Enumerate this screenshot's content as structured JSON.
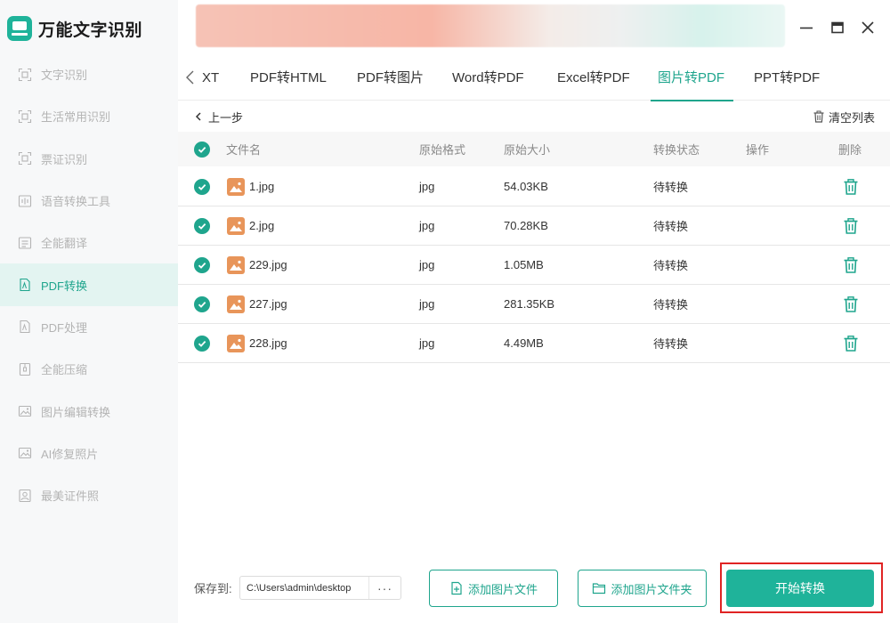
{
  "app": {
    "name": "万能文字识别"
  },
  "colors": {
    "accent": "#1fa58d",
    "button": "#1fb39a",
    "highlight": "#e02424",
    "file_icon": "#e8955a"
  },
  "sidebar": {
    "items": [
      {
        "label": "文字识别",
        "icon": "ocr-icon"
      },
      {
        "label": "生活常用识别",
        "icon": "ocr-icon"
      },
      {
        "label": "票证识别",
        "icon": "ocr-icon"
      },
      {
        "label": "语音转换工具",
        "icon": "audio-icon"
      },
      {
        "label": "全能翻译",
        "icon": "translate-icon"
      },
      {
        "label": "PDF转换",
        "icon": "pdf-icon",
        "active": true
      },
      {
        "label": "PDF处理",
        "icon": "pdf-icon"
      },
      {
        "label": "全能压缩",
        "icon": "compress-icon"
      },
      {
        "label": "图片编辑转换",
        "icon": "image-icon"
      },
      {
        "label": "AI修复照片",
        "icon": "image-icon"
      },
      {
        "label": "最美证件照",
        "icon": "id-photo-icon"
      }
    ]
  },
  "tabs": [
    {
      "label": "XT"
    },
    {
      "label": "PDF转HTML"
    },
    {
      "label": "PDF转图片"
    },
    {
      "label": "Word转PDF"
    },
    {
      "label": "Excel转PDF"
    },
    {
      "label": "图片转PDF",
      "active": true
    },
    {
      "label": "PPT转PDF"
    }
  ],
  "toolbar": {
    "back_label": "上一步",
    "clear_label": "清空列表"
  },
  "table": {
    "headers": {
      "filename": "文件名",
      "format": "原始格式",
      "size": "原始大小",
      "status": "转换状态",
      "action": "操作",
      "delete": "删除"
    },
    "rows": [
      {
        "filename": "1.jpg",
        "format": "jpg",
        "size": "54.03KB",
        "status": "待转换"
      },
      {
        "filename": "2.jpg",
        "format": "jpg",
        "size": "70.28KB",
        "status": "待转换"
      },
      {
        "filename": "229.jpg",
        "format": "jpg",
        "size": "1.05MB",
        "status": "待转换"
      },
      {
        "filename": "227.jpg",
        "format": "jpg",
        "size": "281.35KB",
        "status": "待转换"
      },
      {
        "filename": "228.jpg",
        "format": "jpg",
        "size": "4.49MB",
        "status": "待转换"
      }
    ]
  },
  "footer": {
    "save_label": "保存到:",
    "save_path": "C:\\Users\\admin\\desktop",
    "browse_label": "···",
    "add_files_label": "添加图片文件",
    "add_folder_label": "添加图片文件夹",
    "start_label": "开始转换"
  }
}
